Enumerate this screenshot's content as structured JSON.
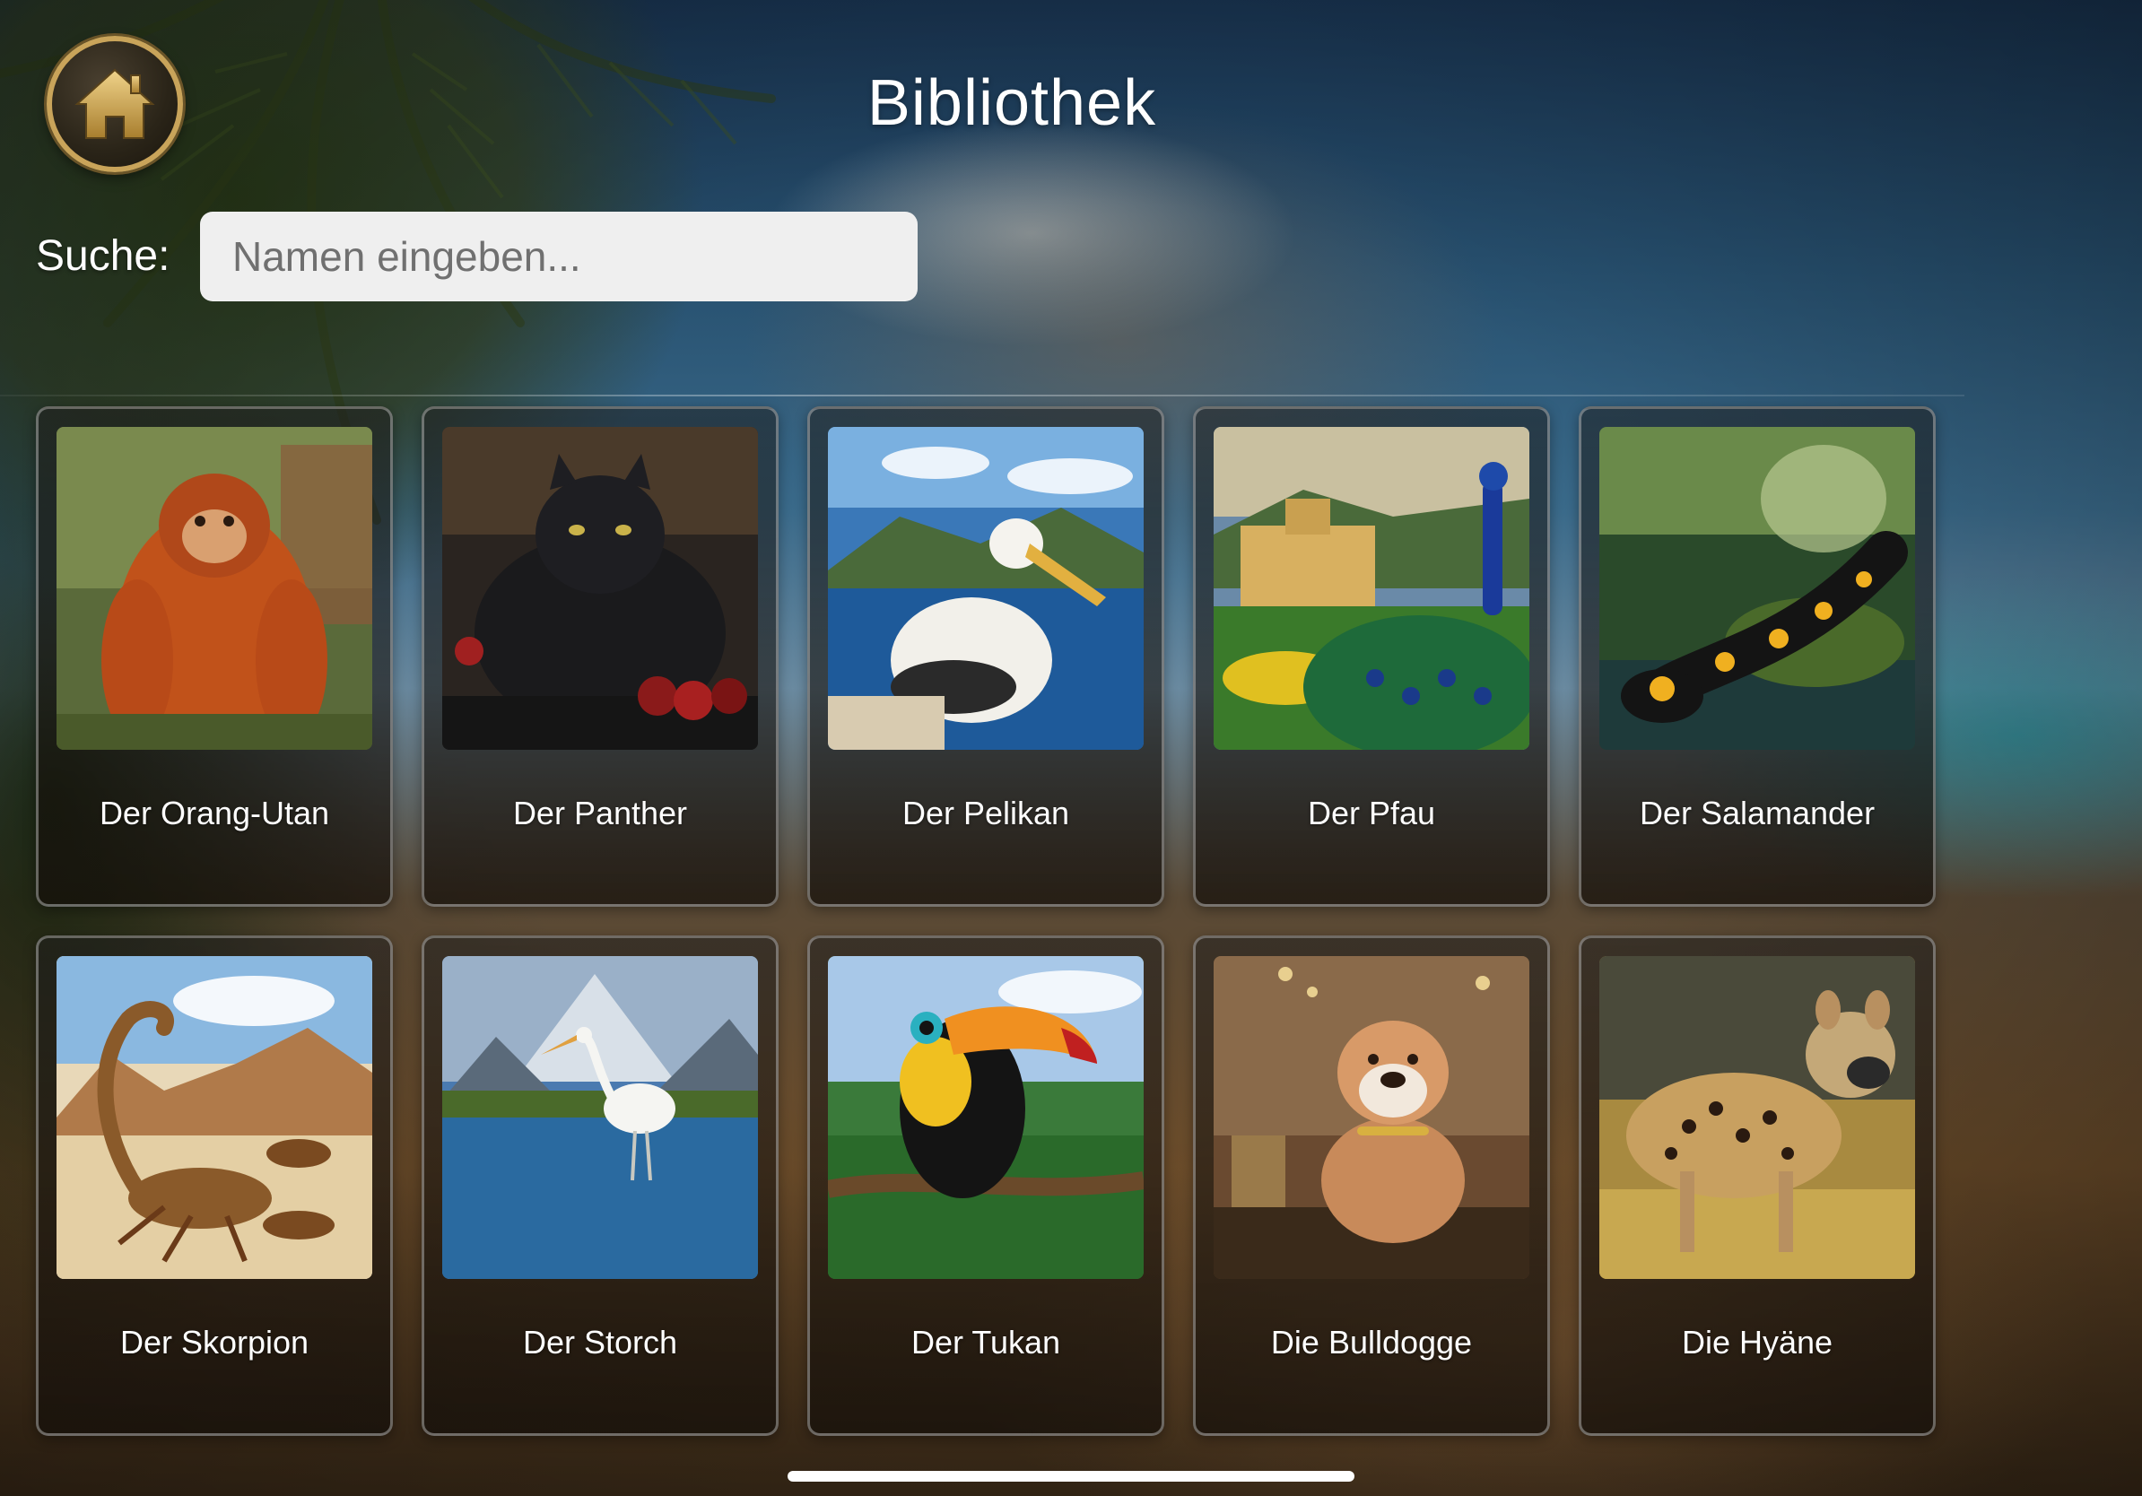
{
  "header": {
    "title": "Bibliothek",
    "home_icon": "home-icon"
  },
  "search": {
    "label": "Suche:",
    "placeholder": "Namen eingeben...",
    "value": ""
  },
  "colors": {
    "home_ring": "#c9a45a",
    "text": "#ffffff",
    "search_bg": "#efefef"
  },
  "cards": [
    {
      "label": "Der Orang-Utan",
      "image": "orangutan-image"
    },
    {
      "label": "Der Panther",
      "image": "panther-image"
    },
    {
      "label": "Der Pelikan",
      "image": "pelican-image"
    },
    {
      "label": "Der Pfau",
      "image": "peacock-image"
    },
    {
      "label": "Der Salamander",
      "image": "salamander-image"
    },
    {
      "label": "Der Skorpion",
      "image": "scorpion-image"
    },
    {
      "label": "Der Storch",
      "image": "stork-image"
    },
    {
      "label": "Der Tukan",
      "image": "toucan-image"
    },
    {
      "label": "Die Bulldogge",
      "image": "bulldog-image"
    },
    {
      "label": "Die Hyäne",
      "image": "hyena-image"
    }
  ]
}
